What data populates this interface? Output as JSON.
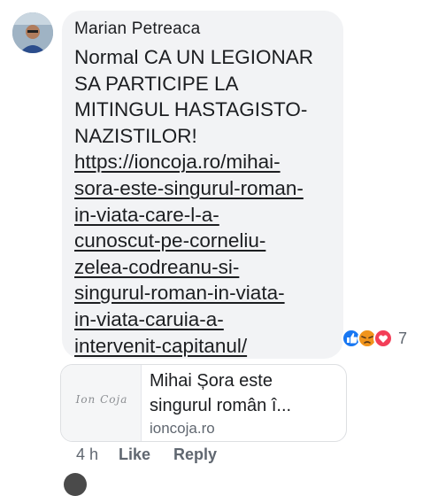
{
  "comment": {
    "author": "Marian Petreaca",
    "text_lines": [
      "Normal CA UN LEGIONAR",
      "SA PARTICIPE LA",
      "MITINGUL HASTAGISTO-",
      "NAZISTILOR!"
    ],
    "link_lines": [
      "https://ioncoja.ro/mihai-",
      "sora-este-singurul-roman-",
      "in-viata-care-l-a-",
      "cunoscut-pe-corneliu-",
      "zelea-codreanu-si-",
      "singurul-roman-in-viata-",
      "in-viata-caruia-a-",
      "intervenit-capitanul/"
    ],
    "reactions": {
      "icons": [
        "like-reaction-icon",
        "angry-reaction-icon",
        "love-reaction-icon"
      ],
      "count": "7"
    }
  },
  "link_preview": {
    "thumbnail_text": "Ion Coja",
    "title_lines": [
      "Mihai Șora este",
      "singurul român î..."
    ],
    "domain": "ioncoja.ro"
  },
  "actions": {
    "time": "4 h",
    "like_label": "Like",
    "reply_label": "Reply"
  },
  "colors": {
    "bubble_bg": "#f2f3f5",
    "text": "#1c1e21",
    "meta": "#606770",
    "like_blue": "#1877f2",
    "angry_orange": "#f7b125",
    "love_red": "#f33e58"
  }
}
